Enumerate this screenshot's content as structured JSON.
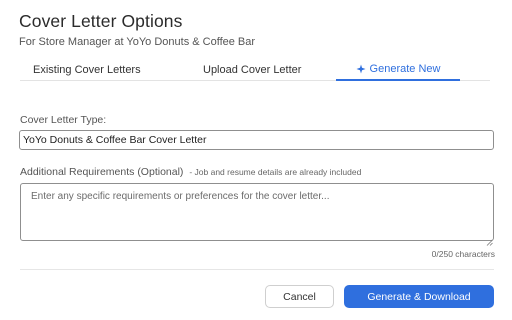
{
  "dialog": {
    "title": "Cover Letter Options",
    "subtitle": "For Store Manager at YoYo Donuts & Coffee Bar"
  },
  "tabs": [
    {
      "label": "Existing Cover Letters",
      "active": false
    },
    {
      "label": "Upload Cover Letter",
      "active": false
    },
    {
      "label": "Generate New",
      "active": true,
      "icon": "sparkle-icon"
    }
  ],
  "form": {
    "type_label": "Cover Letter Type:",
    "type_value": "YoYo Donuts & Coffee Bar Cover Letter",
    "requirements_label": "Additional Requirements (Optional)",
    "requirements_hint": "- Job and resume details are already included",
    "requirements_placeholder": "Enter any specific requirements or preferences for the cover letter...",
    "char_count": "0/250 characters"
  },
  "actions": {
    "cancel_label": "Cancel",
    "generate_label": "Generate & Download"
  },
  "colors": {
    "accent": "#2f6fde"
  }
}
